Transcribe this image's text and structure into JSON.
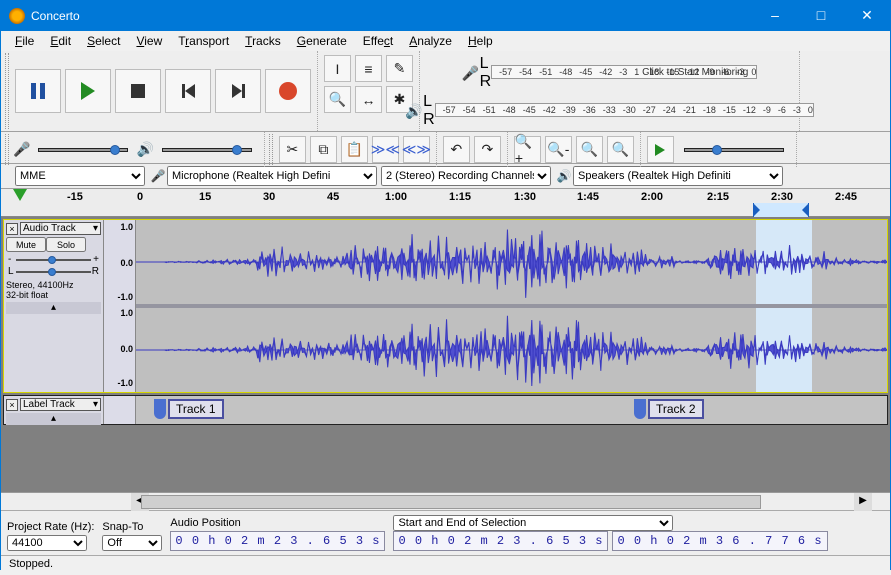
{
  "window": {
    "title": "Concerto"
  },
  "menu": {
    "file": "File",
    "edit": "Edit",
    "select": "Select",
    "view": "View",
    "transport": "Transport",
    "tracks": "Tracks",
    "generate": "Generate",
    "effect": "Effect",
    "analyze": "Analyze",
    "help": "Help"
  },
  "meter": {
    "ticks_rec": [
      "-57",
      "-54",
      "-51",
      "-48",
      "-45",
      "-42",
      "-3"
    ],
    "monitor_text": "Click to Start Monitoring",
    "ticks_rec2": [
      "1",
      "-18",
      "-15",
      "-12",
      "-9",
      "-6",
      "-3",
      "0"
    ],
    "ticks_play": [
      "-57",
      "-54",
      "-51",
      "-48",
      "-45",
      "-42",
      "-39",
      "-36",
      "-33",
      "-30",
      "-27",
      "-24",
      "-21",
      "-18",
      "-15",
      "-12",
      "-9",
      "-6",
      "-3",
      "0"
    ]
  },
  "devices": {
    "host": "MME",
    "input": "Microphone (Realtek High Defini",
    "channels": "2 (Stereo) Recording Channels",
    "output": "Speakers (Realtek High Definiti"
  },
  "ruler": {
    "ticks": [
      "-15",
      "0",
      "15",
      "30",
      "45",
      "1:00",
      "1:15",
      "1:30",
      "1:45",
      "2:00",
      "2:15",
      "2:30",
      "2:45"
    ]
  },
  "tracks": {
    "audio": {
      "name": "Audio Track",
      "mute": "Mute",
      "solo": "Solo",
      "info1": "Stereo, 44100Hz",
      "info2": "32-bit float",
      "scale": [
        "1.0",
        "0.0",
        "-1.0",
        "1.0",
        "0.0",
        "-1.0"
      ]
    },
    "label": {
      "name": "Label Track",
      "labels": [
        "Track 1",
        "Track 2"
      ]
    }
  },
  "bottom": {
    "rate_label": "Project Rate (Hz):",
    "rate": "44100",
    "snap_label": "Snap-To",
    "snap": "Off",
    "pos_label": "Audio Position",
    "pos": "0 0 h 0 2 m 2 3 . 6 5 3 s",
    "sel_label": "Start and End of Selection",
    "sel_start": "0 0 h 0 2 m 2 3 . 6 5 3 s",
    "sel_end": "0 0 h 0 2 m 3 6 . 7 7 6 s"
  },
  "status": "Stopped."
}
